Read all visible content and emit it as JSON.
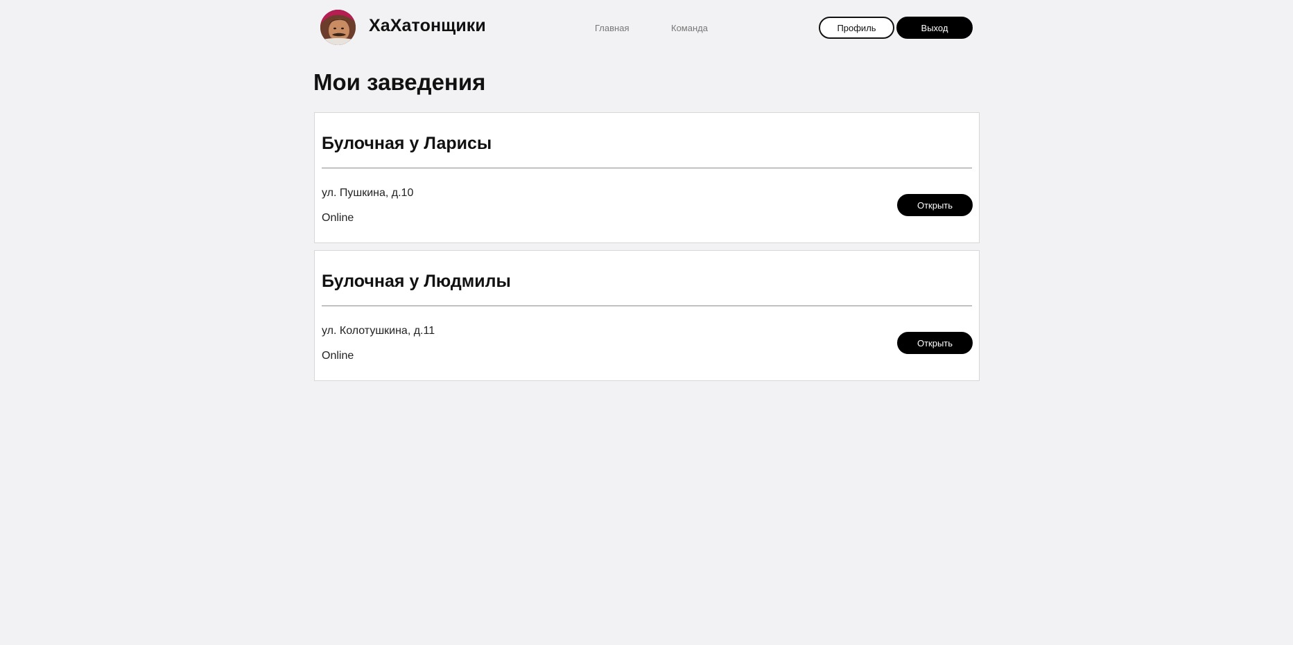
{
  "header": {
    "brand": "ХаХатонщики",
    "nav": [
      {
        "label": "Главная"
      },
      {
        "label": "Команда"
      }
    ],
    "profile_label": "Профиль",
    "logout_label": "Выход"
  },
  "main": {
    "title": "Мои заведения",
    "places": [
      {
        "name": "Булочная у Ларисы",
        "address": "ул. Пушкина, д.10",
        "status": "Online",
        "open_label": "Открыть"
      },
      {
        "name": "Булочная у Людмилы",
        "address": "ул. Колотушкина, д.11",
        "status": "Online",
        "open_label": "Открыть"
      }
    ]
  },
  "colors": {
    "background": "#f2f2f4",
    "primary_button": "#000000",
    "card_background": "#ffffff",
    "nav_text": "#777777"
  },
  "icons": {
    "avatar": "team-avatar-photo"
  }
}
